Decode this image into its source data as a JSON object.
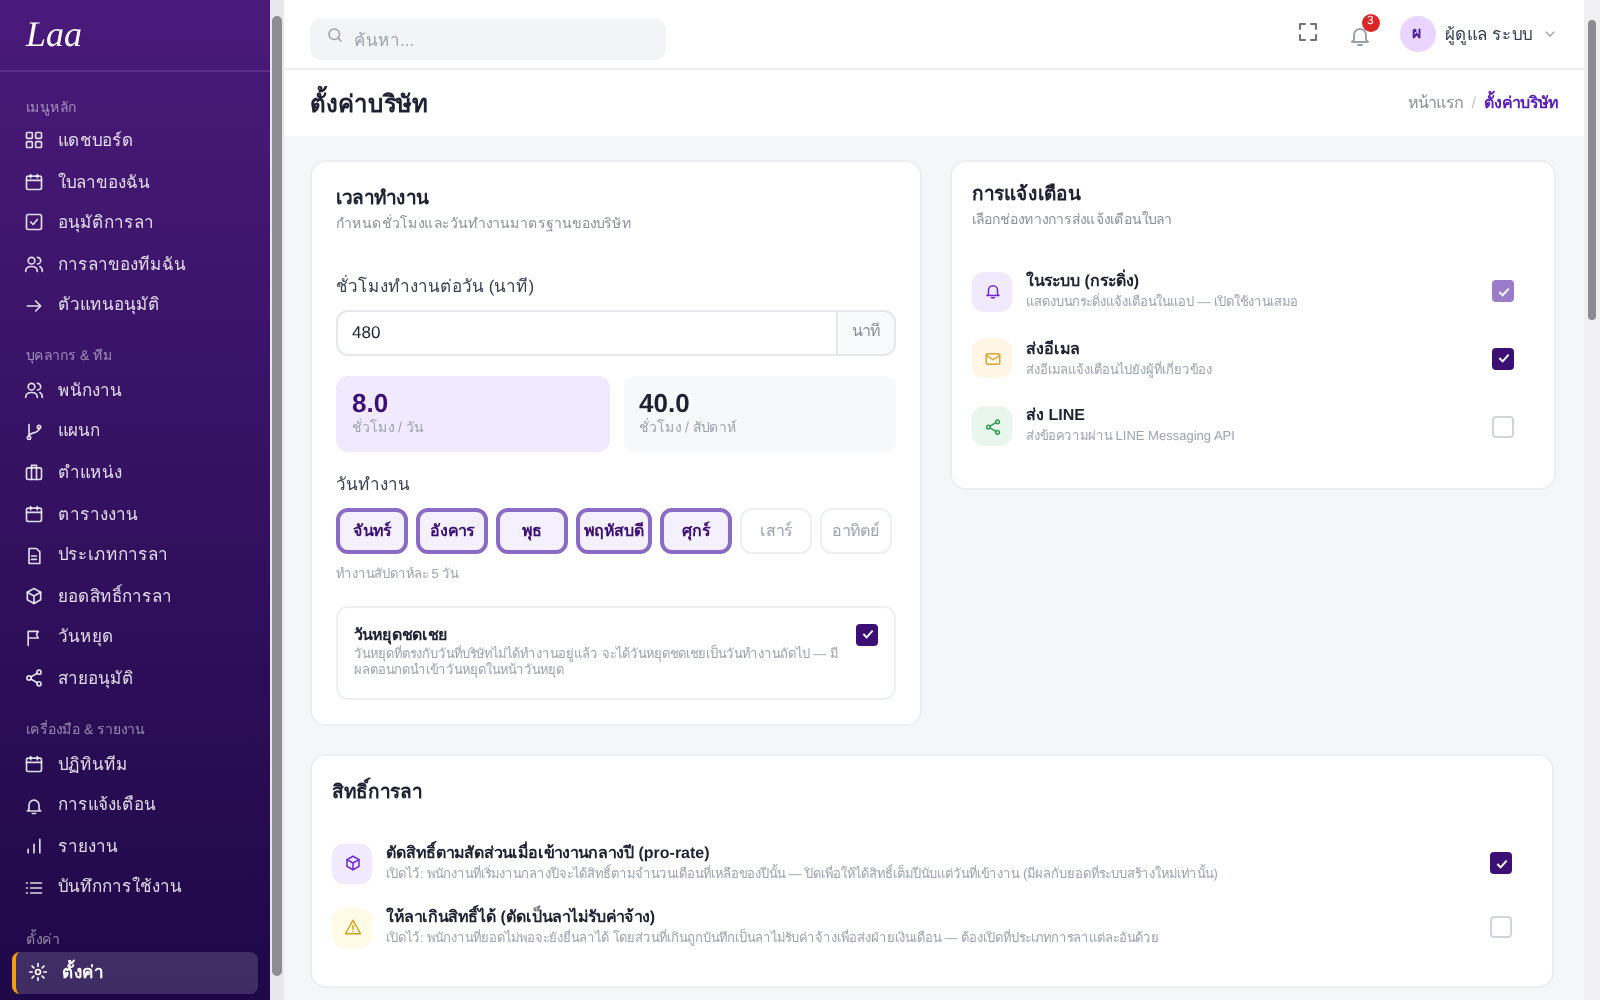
{
  "sidebar": {
    "logo": "Laa",
    "sections": [
      {
        "title": "เมนูหลัก",
        "items": [
          {
            "label": "แดชบอร์ด",
            "selected": false
          },
          {
            "label": "ใบลาของฉัน",
            "selected": false
          },
          {
            "label": "อนุมัติการลา",
            "selected": false
          },
          {
            "label": "การลาของทีมฉัน",
            "selected": false
          },
          {
            "label": "ตัวแทนอนุมัติ",
            "selected": false
          }
        ]
      },
      {
        "title": "บุคลากร & ทีม",
        "items": [
          {
            "label": "พนักงาน",
            "selected": false
          },
          {
            "label": "แผนก",
            "selected": false
          },
          {
            "label": "ตำแหน่ง",
            "selected": false
          },
          {
            "label": "ตารางงาน",
            "selected": false
          },
          {
            "label": "ประเภทการลา",
            "selected": false
          },
          {
            "label": "ยอดสิทธิ์การลา",
            "selected": false
          },
          {
            "label": "วันหยุด",
            "selected": false
          },
          {
            "label": "สายอนุมัติ",
            "selected": false
          }
        ]
      },
      {
        "title": "เครื่องมือ & รายงาน",
        "items": [
          {
            "label": "ปฏิทินทีม",
            "selected": false
          },
          {
            "label": "การแจ้งเตือน",
            "selected": false
          },
          {
            "label": "รายงาน",
            "selected": false
          },
          {
            "label": "บันทึกการใช้งาน",
            "selected": false
          }
        ]
      },
      {
        "title": "ตั้งค่า",
        "items": [
          {
            "label": "ตั้งค่า",
            "selected": true
          }
        ]
      }
    ]
  },
  "topbar": {
    "search": {
      "placeholder": "ค้นหา..."
    },
    "notification_count": "3",
    "user": {
      "initial": "ผ",
      "name": "ผู้ดูแล ระบบ"
    }
  },
  "page": {
    "title": "ตั้งค่าบริษัท",
    "breadcrumb": [
      "หน้าแรก",
      "ตั้งค่าบริษัท"
    ],
    "breadcrumb_separator": "/"
  },
  "work_hours": {
    "title": "เวลาทำงาน",
    "subtitle": "กำหนดชั่วโมงและวันทำงานมาตรฐานของบริษัท",
    "field_label": "ชั่วโมงทำงานต่อวัน (นาที)",
    "field_value": "480",
    "field_unit": "นาที",
    "stats": [
      {
        "value": "8.0",
        "label": "ชั่วโมง / วัน",
        "selected": true
      },
      {
        "value": "40.0",
        "label": "ชั่วโมง / สัปดาห์",
        "selected": false
      }
    ],
    "days_label": "วันทำงาน",
    "days": [
      {
        "label": "จันทร์",
        "selected": true
      },
      {
        "label": "อังคาร",
        "selected": true
      },
      {
        "label": "พุธ",
        "selected": true
      },
      {
        "label": "พฤหัสบดี",
        "selected": true
      },
      {
        "label": "ศุกร์",
        "selected": true
      },
      {
        "label": "เสาร์",
        "selected": false
      },
      {
        "label": "อาทิตย์",
        "selected": false
      }
    ],
    "days_note": "ทำงานสัปดาห์ละ 5 วัน",
    "compensation": {
      "title": "วันหยุดชดเชย",
      "description": "วันหยุดที่ตรงกับวันที่บริษัทไม่ได้ทำงานอยู่แล้ว จะได้วันหยุดชดเชยเป็นวันทำงานถัดไป — มีผลตอนกดนำเข้าวันหยุดในหน้าวันหยุด",
      "checked": true
    }
  },
  "notifications": {
    "title": "การแจ้งเตือน",
    "subtitle": "เลือกช่องทางการส่งแจ้งเตือนใบลา",
    "channels": [
      {
        "kind": "bell",
        "title": "ในระบบ (กระดิ่ง)",
        "description": "แสดงบนกระดิ่งแจ้งเตือนในแอป — เปิดใช้งานเสมอ",
        "checked": true,
        "disabled": true
      },
      {
        "kind": "mail",
        "title": "ส่งอีเมล",
        "description": "ส่งอีเมลแจ้งเตือนไปยังผู้ที่เกี่ยวข้อง",
        "checked": true,
        "disabled": false
      },
      {
        "kind": "share",
        "title": "ส่ง LINE",
        "description": "ส่งข้อความผ่าน LINE Messaging API",
        "checked": false,
        "disabled": false
      }
    ]
  },
  "leave_rights": {
    "title": "สิทธิ์การลา",
    "options": [
      {
        "kind": "box",
        "title": "ตัดสิทธิ์ตามสัดส่วนเมื่อเข้างานกลางปี (pro-rate)",
        "description": "เปิดไว้: พนักงานที่เริ่มงานกลางปีจะได้สิทธิ์ตามจำนวนเดือนที่เหลือของปีนั้น — ปิดเพื่อให้ได้สิทธิ์เต็มปีนับแต่วันที่เข้างาน (มีผลกับยอดที่ระบบสร้างใหม่เท่านั้น)",
        "checked": true
      },
      {
        "kind": "warning",
        "title": "ให้ลาเกินสิทธิ์ได้ (ตัดเป็นลาไม่รับค่าจ้าง)",
        "description": "เปิดไว้: พนักงานที่ยอดไม่พอจะยังยื่นลาได้ โดยส่วนที่เกินถูกบันทึกเป็นลาไม่รับค่าจ้างเพื่อส่งฝ่ายเงินเดือน — ต้องเปิดที่ประเภทการลาแต่ละอันด้วย",
        "checked": false
      }
    ]
  }
}
